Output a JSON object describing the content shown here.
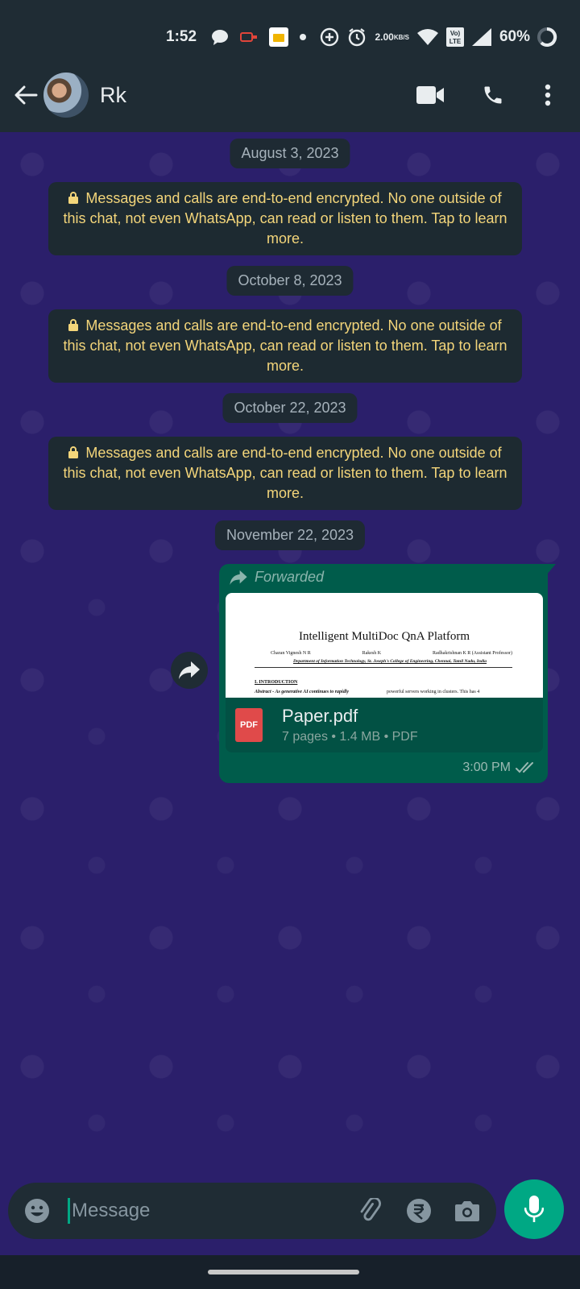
{
  "status_bar": {
    "time": "1:52",
    "net_speed_value": "2.00",
    "net_speed_unit": "KB/S",
    "volte": "VoLTE",
    "battery": "60%"
  },
  "header": {
    "contact_name": "Rk"
  },
  "chat": {
    "dates": [
      "August 3, 2023",
      "October 8, 2023",
      "October 22, 2023",
      "November 22, 2023"
    ],
    "encryption_notice": "Messages and calls are end-to-end encrypted. No one outside of this chat, not even WhatsApp, can read or listen to them. Tap to learn more.",
    "message": {
      "forwarded_label": "Forwarded",
      "doc_preview": {
        "title": "Intelligent MultiDoc QnA Platform",
        "author1": "Charan Vignesh N R",
        "author2": "Rakesh K",
        "author3": "Radhakrishnan K R (Assistant Professor)",
        "department": "Department of Information Technology, St. Joseph's College of Engineering, Chennai, Tamil Nadu, India",
        "section": "I. INTRODUCTION",
        "abstract": "Abstract - As generative AI continues to rapidly",
        "col2": "powerful servers working in clusters. This has 4"
      },
      "file_name": "Paper.pdf",
      "file_meta": "7 pages • 1.4 MB • PDF",
      "pdf_badge": "PDF",
      "time": "3:00 PM"
    }
  },
  "input_bar": {
    "placeholder": "Message"
  },
  "colors": {
    "header_bg": "#1f2c34",
    "chat_bg": "#2b1f6b",
    "outgoing_bubble": "#005c4b",
    "accent": "#00a884",
    "notice_text": "#f3d57a"
  }
}
